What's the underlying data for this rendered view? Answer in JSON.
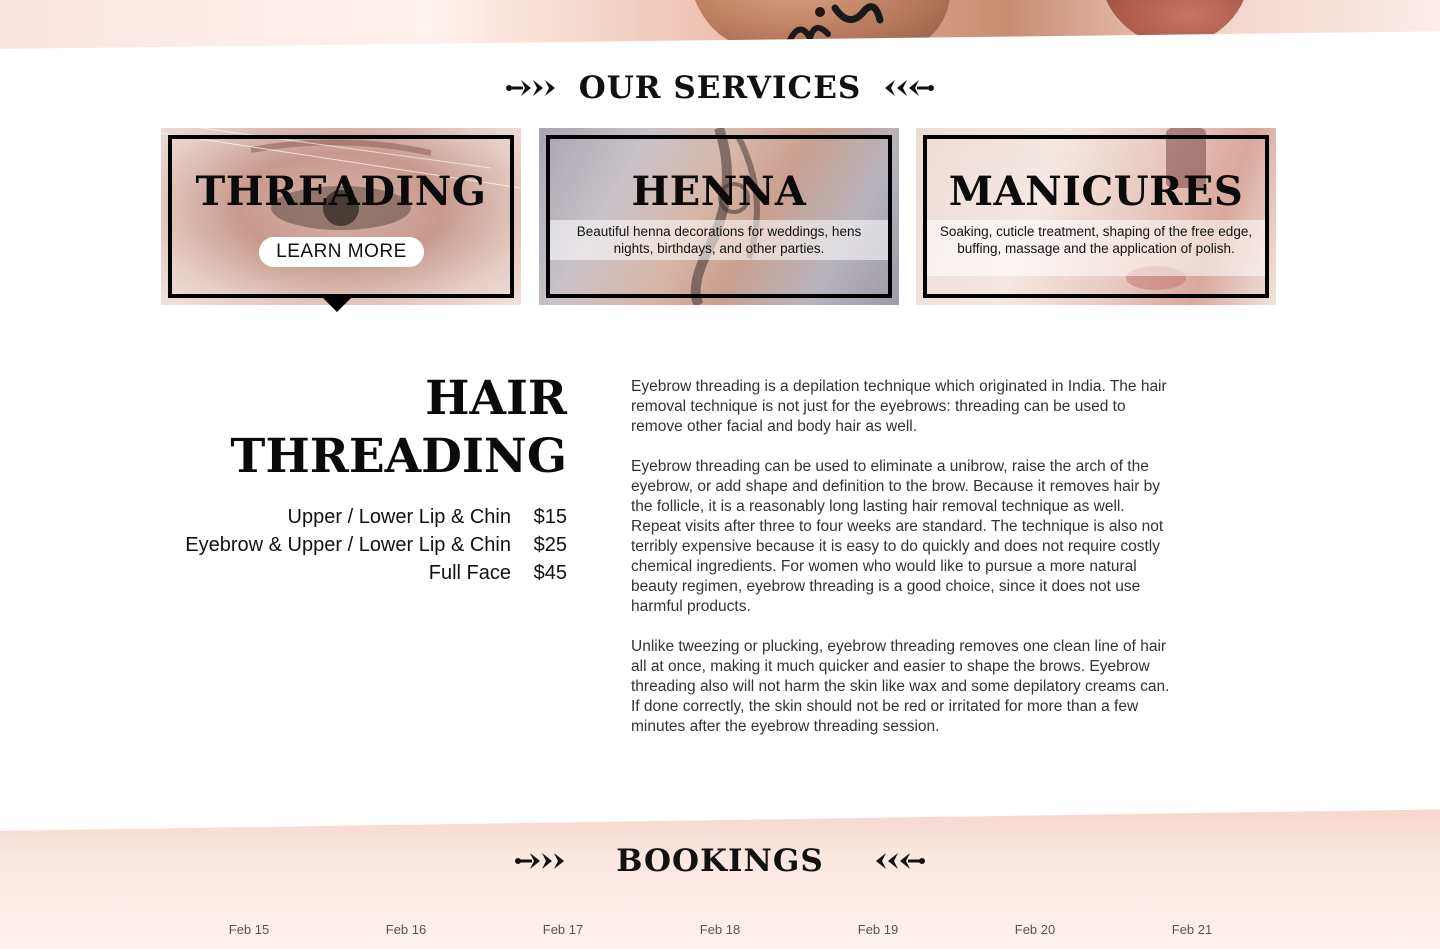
{
  "services_section": {
    "heading": "OUR SERVICES"
  },
  "cards": [
    {
      "title": "THREADING",
      "button": "LEARN MORE"
    },
    {
      "title": "HENNA",
      "description": "Beautiful henna decorations for weddings, hens nights, birthdays, and other parties."
    },
    {
      "title": "MANICURES",
      "description": "Soaking, cuticle treatment, shaping of the free edge, buffing, massage and the application of polish."
    }
  ],
  "detail": {
    "title_line1": "HAIR",
    "title_line2": "THREADING",
    "prices": [
      {
        "item": "Upper / Lower Lip & Chin",
        "price": "$15"
      },
      {
        "item": "Eyebrow & Upper / Lower Lip & Chin",
        "price": "$25"
      },
      {
        "item": "Full Face",
        "price": "$45"
      }
    ],
    "paragraphs": [
      "Eyebrow threading is a depilation technique which originated in India. The hair removal technique is not just for the eyebrows: threading can be used to remove other facial and body hair as well.",
      "Eyebrow threading can be used to eliminate a unibrow, raise the arch of the eyebrow, or add shape and definition to the brow. Because it removes hair by the follicle, it is a reasonably long lasting hair removal technique as well. Repeat visits after three to four weeks are standard. The technique is also not terribly expensive because it is easy to do quickly and does not require costly chemical ingredients. For women who would like to pursue a more natural beauty regimen, eyebrow threading is a good choice, since it does not use harmful products.",
      "Unlike tweezing or plucking, eyebrow threading removes one clean line of hair all at once, making it much quicker and easier to shape the brows. Eyebrow threading also will not harm the skin like wax and some depilatory creams can. If done correctly, the skin should not be red or irritated for more than a few minutes after the eyebrow threading session."
    ]
  },
  "bookings": {
    "heading": "BOOKINGS",
    "dates": [
      "Feb 15",
      "Feb 16",
      "Feb 17",
      "Feb 18",
      "Feb 19",
      "Feb 20",
      "Feb 21"
    ]
  },
  "colors": {
    "accent_pink": "#f6d3ca",
    "text_dark": "#111111",
    "frame_black": "#000000"
  }
}
